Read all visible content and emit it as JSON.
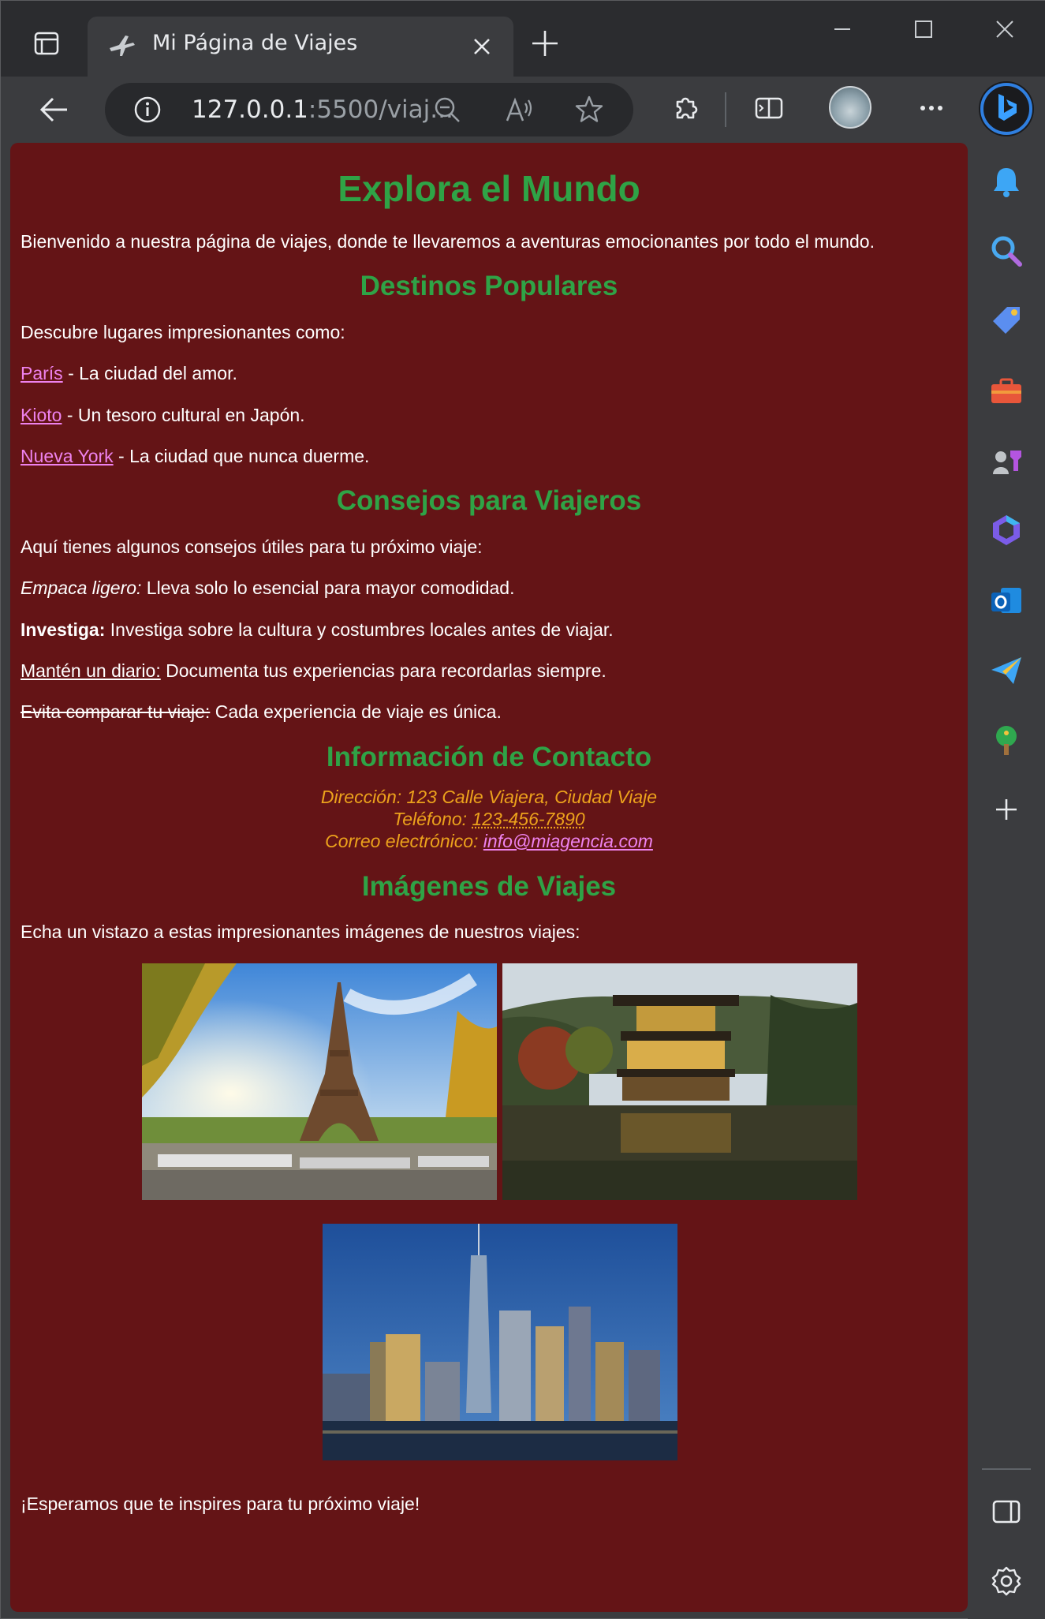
{
  "browser": {
    "tab_title": "Mi Página de Viajes",
    "url_host": "127.0.0.1",
    "url_rest": ":5500/viaj..."
  },
  "page": {
    "heading": "Explora el Mundo",
    "intro": "Bienvenido a nuestra página de viajes, donde te llevaremos a aventuras emocionantes por todo el mundo.",
    "destinations": {
      "heading": "Destinos Populares",
      "lead": "Descubre lugares impresionantes como:",
      "items": [
        {
          "link": "París",
          "text": " - La ciudad del amor."
        },
        {
          "link": "Kioto",
          "text": " - Un tesoro cultural en Japón."
        },
        {
          "link": "Nueva York",
          "text": " - La ciudad que nunca duerme."
        }
      ]
    },
    "tips": {
      "heading": "Consejos para Viajeros",
      "lead": "Aquí tienes algunos consejos útiles para tu próximo viaje:",
      "items": [
        {
          "label": "Empaca ligero:",
          "text": " Lleva solo lo esencial para mayor comodidad."
        },
        {
          "label": "Investiga:",
          "text": " Investiga sobre la cultura y costumbres locales antes de viajar."
        },
        {
          "label": "Mantén un diario:",
          "text": " Documenta tus experiencias para recordarlas siempre."
        },
        {
          "label": "Evita comparar tu viaje:",
          "text": " Cada experiencia de viaje es única."
        }
      ]
    },
    "contact": {
      "heading": "Información de Contacto",
      "address": "Dirección: 123 Calle Viajera, Ciudad Viaje",
      "phone_label": "Teléfono: ",
      "phone": "123-456-7890",
      "email_label": "Correo electrónico: ",
      "email": "info@miagencia.com"
    },
    "images": {
      "heading": "Imágenes de Viajes",
      "lead": "Echa un vistazo a estas impresionantes imágenes de nuestros viajes:"
    },
    "closing": "¡Esperamos que te inspires para tu próximo viaje!"
  },
  "colors": {
    "page_bg": "#641416",
    "heading": "#2fa346",
    "link": "#ee82ee",
    "contact": "#eca21c"
  },
  "icons": {
    "sidebar": [
      "bell-icon",
      "search-icon",
      "tag-icon",
      "toolbox-icon",
      "games-icon",
      "copilot-icon",
      "outlook-icon",
      "send-icon",
      "tree-icon",
      "add-icon",
      "sidebar-toggle-icon",
      "settings-icon"
    ]
  }
}
